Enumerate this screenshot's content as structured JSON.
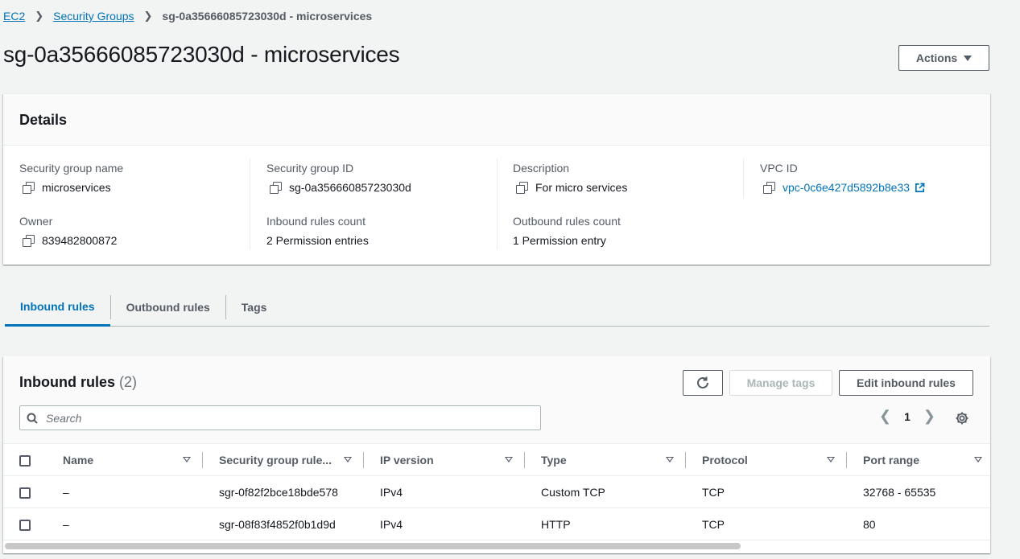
{
  "breadcrumb": {
    "items": [
      "EC2",
      "Security Groups"
    ],
    "current": "sg-0a35666085723030d - microservices"
  },
  "page": {
    "title": "sg-0a35666085723030d - microservices",
    "actions_label": "Actions"
  },
  "details": {
    "title": "Details",
    "fields": {
      "sg_name": {
        "label": "Security group name",
        "value": "microservices"
      },
      "sg_id": {
        "label": "Security group ID",
        "value": "sg-0a35666085723030d"
      },
      "description": {
        "label": "Description",
        "value": "For micro services"
      },
      "vpc_id": {
        "label": "VPC ID",
        "value": "vpc-0c6e427d5892b8e33"
      },
      "owner": {
        "label": "Owner",
        "value": "839482800872"
      },
      "inbound_count": {
        "label": "Inbound rules count",
        "value": "2 Permission entries"
      },
      "outbound_count": {
        "label": "Outbound rules count",
        "value": "1 Permission entry"
      }
    }
  },
  "tabs": [
    "Inbound rules",
    "Outbound rules",
    "Tags"
  ],
  "inbound": {
    "title": "Inbound rules",
    "count": "(2)",
    "manage_tags_label": "Manage tags",
    "edit_label": "Edit inbound rules",
    "search_placeholder": "Search",
    "page": "1",
    "columns": [
      "Name",
      "Security group rule...",
      "IP version",
      "Type",
      "Protocol",
      "Port range"
    ],
    "rows": [
      {
        "name": "–",
        "rule_id": "sgr-0f82f2bce18bde578",
        "ip_version": "IPv4",
        "type": "Custom TCP",
        "protocol": "TCP",
        "port_range": "32768 - 65535"
      },
      {
        "name": "–",
        "rule_id": "sgr-08f83f4852f0b1d9d",
        "ip_version": "IPv4",
        "type": "HTTP",
        "protocol": "TCP",
        "port_range": "80"
      }
    ]
  },
  "colors": {
    "link": "#0073bb",
    "text": "#16191f",
    "muted": "#545b64",
    "background": "#f2f3f3"
  }
}
